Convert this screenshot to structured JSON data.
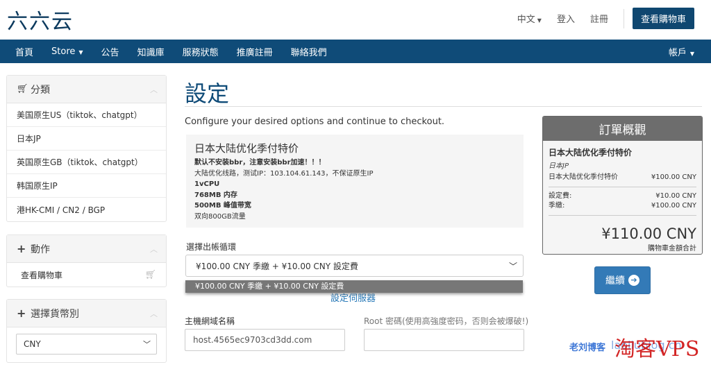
{
  "header": {
    "logo": "六六云",
    "language": "中文",
    "login": "登入",
    "register": "註冊",
    "view_cart": "查看購物車"
  },
  "nav": {
    "items": [
      "首頁",
      "Store",
      "公告",
      "知識庫",
      "服務狀態",
      "推廣註冊",
      "聯絡我們"
    ],
    "account": "帳戶"
  },
  "sidebar": {
    "categories_title": "分類",
    "categories": [
      "美国原生US（tiktok、chatgpt）",
      "日本JP",
      "英国原生GB（tiktok、chatgpt）",
      "韩国原生IP",
      "港HK-CMI / CN2 / BGP"
    ],
    "actions_title": "動作",
    "actions": [
      "查看購物車"
    ],
    "currency_title": "選擇貨幣別",
    "currency_value": "CNY"
  },
  "main": {
    "title": "設定",
    "intro": "Configure your desired options and continue to checkout.",
    "product": {
      "name": "日本大陆优化季付特价",
      "lines": [
        {
          "text": "默认不安装bbr，注意安装bbr加速！！！",
          "bold": true
        },
        {
          "text": "大陆优化线路，测试IP：103.104.61.143，不保证原生IP",
          "bold": false
        },
        {
          "text": "1vCPU",
          "bold": true
        },
        {
          "text": "768MB 内存",
          "bold": true
        },
        {
          "text": "500MB 峰值带宽",
          "bold": true
        },
        {
          "text": "双向800GB流量",
          "bold": false
        }
      ]
    },
    "cycle_label": "選擇出帳循環",
    "cycle_value": "¥100.00 CNY 季繳 + ¥10.00 CNY 設定費",
    "cycle_option": "¥100.00 CNY 季繳 + ¥10.00 CNY 設定費",
    "config_link": "設定伺服器",
    "hostname_label": "主機網域名稱",
    "hostname_value": "host.4565ec9703cd3dd.com",
    "root_label": "Root 密碼(使用高強度密码，否则会被爆破!)"
  },
  "summary": {
    "title": "訂單概觀",
    "product": "日本大陆优化季付特价",
    "group": "日本JP",
    "line_item": {
      "label": "日本大陆优化季付特价",
      "value": "¥100.00 CNY"
    },
    "setup_fee": {
      "label": "設定費:",
      "value": "¥10.00 CNY"
    },
    "quarterly": {
      "label": "季繳:",
      "value": "¥100.00 CNY"
    },
    "total": "¥110.00 CNY",
    "total_label": "購物車金額合計",
    "continue": "繼續"
  },
  "watermarks": {
    "blog": "老刘博客",
    "brand": "淘客VPS",
    "url": "laoliublog.cn"
  },
  "colors": {
    "brand": "#0f4b78",
    "accent": "#337ab7",
    "summary_head": "#6d6d6d"
  }
}
